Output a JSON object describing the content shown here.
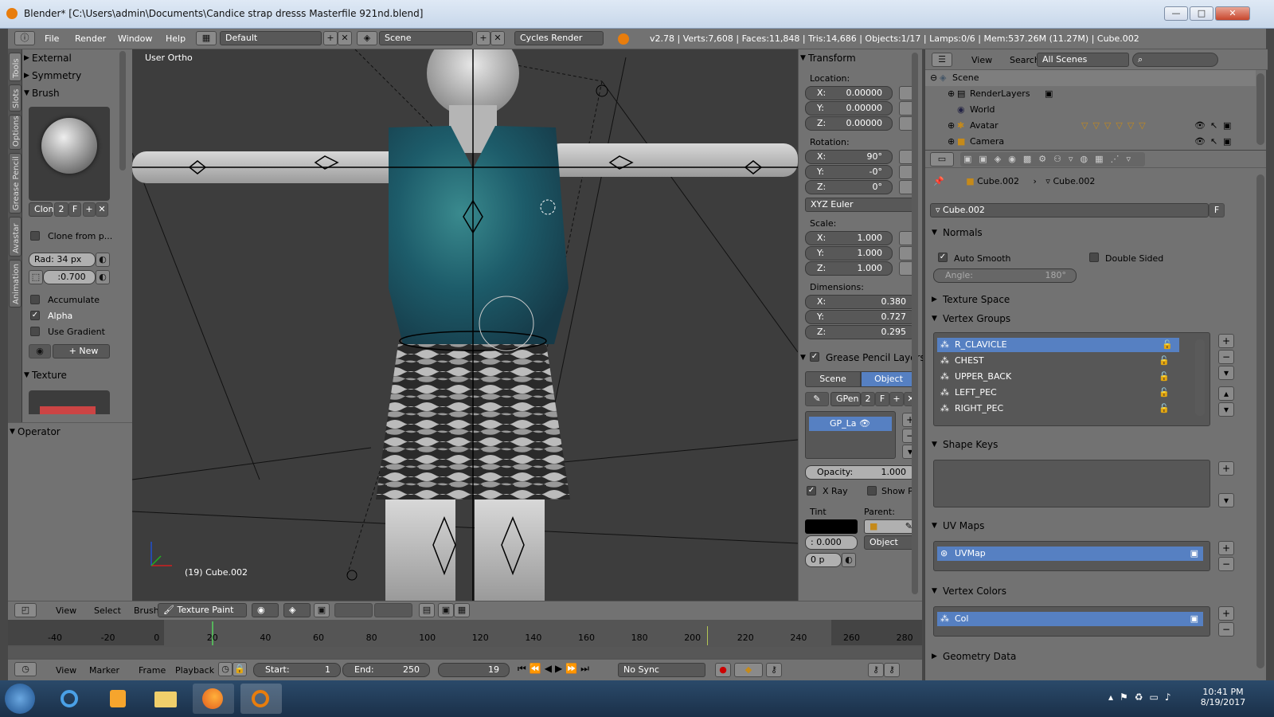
{
  "window": {
    "title": "Blender* [C:\\Users\\admin\\Documents\\Candice strap dresss Masterfile 921nd.blend]",
    "minimize": "—",
    "maximize": "□",
    "close": "✕"
  },
  "infobar": {
    "menus": [
      "File",
      "Render",
      "Window",
      "Help"
    ],
    "layout": "Default",
    "scene": "Scene",
    "engine": "Cycles Render",
    "stats": "v2.78 | Verts:7,608 | Faces:11,848 | Tris:14,686 | Objects:1/17 | Lamps:0/6 | Mem:537.26M (11.27M) | Cube.002"
  },
  "vtabs": [
    "Tools",
    "Slots",
    "Options",
    "Grease Pencil",
    "Avastar",
    "Animation"
  ],
  "toolshelf": {
    "external": "External",
    "symmetry": "Symmetry",
    "brush": "Brush",
    "brush_name": "Clon",
    "brush_users": "2",
    "brush_fake": "F",
    "clone_from": "Clone from p...",
    "radius": "Rad: 34 px",
    "strength": ":0.700",
    "accumulate": "Accumulate",
    "alpha": "Alpha",
    "use_gradient": "Use Gradient",
    "new_button": "New",
    "texture": "Texture",
    "operator": "Operator"
  },
  "viewport": {
    "view_name": "User Ortho",
    "object_label": "(19) Cube.002"
  },
  "npanel": {
    "transform": "Transform",
    "location_label": "Location:",
    "location": [
      {
        "k": "X:",
        "v": "0.00000"
      },
      {
        "k": "Y:",
        "v": "0.00000"
      },
      {
        "k": "Z:",
        "v": "0.00000"
      }
    ],
    "rotation_label": "Rotation:",
    "rotation": [
      {
        "k": "X:",
        "v": "90°"
      },
      {
        "k": "Y:",
        "v": "-0°"
      },
      {
        "k": "Z:",
        "v": "0°"
      }
    ],
    "rotation_mode": "XYZ Euler",
    "scale_label": "Scale:",
    "scale": [
      {
        "k": "X:",
        "v": "1.000"
      },
      {
        "k": "Y:",
        "v": "1.000"
      },
      {
        "k": "Z:",
        "v": "1.000"
      }
    ],
    "dimensions_label": "Dimensions:",
    "dimensions": [
      {
        "k": "X:",
        "v": "0.380"
      },
      {
        "k": "Y:",
        "v": "0.727"
      },
      {
        "k": "Z:",
        "v": "0.295"
      }
    ],
    "gp_layers": "Grease Pencil Layers",
    "tab_scene": "Scene",
    "tab_object": "Object",
    "gpen": "GPen",
    "gpen_users": "2",
    "gpen_fake": "F",
    "gp_layer": "GP_La",
    "opacity": "Opacity:",
    "opacity_value": "1.000",
    "xray": "X Ray",
    "show_points": "Show Po",
    "tint": "Tint",
    "parent": "Parent:",
    "tint_value": ": 0.000",
    "parent_type": "Object",
    "thickness": "0 p"
  },
  "outliner": {
    "view": "View",
    "search": "Search",
    "filter": "All Scenes",
    "rows": [
      "Scene",
      "RenderLayers",
      "World",
      "Avatar",
      "Camera"
    ]
  },
  "properties": {
    "breadcrumb_obj": "Cube.002",
    "breadcrumb_mesh": "Cube.002",
    "mesh_name": "Cube.002",
    "fake_user": "F",
    "normals": "Normals",
    "auto_smooth": "Auto Smooth",
    "double_sided": "Double Sided",
    "angle_label": "Angle:",
    "angle_value": "180°",
    "texture_space": "Texture Space",
    "vertex_groups": "Vertex Groups",
    "groups": [
      "R_CLAVICLE",
      "CHEST",
      "UPPER_BACK",
      "LEFT_PEC",
      "RIGHT_PEC"
    ],
    "shape_keys": "Shape Keys",
    "uv_maps": "UV Maps",
    "uv_map": "UVMap",
    "vertex_colors": "Vertex Colors",
    "vcol": "Col",
    "geometry_data": "Geometry Data"
  },
  "v3d_header": {
    "view": "View",
    "select": "Select",
    "brush": "Brush",
    "mode": "Texture Paint"
  },
  "timeline": {
    "ticks": [
      "-40",
      "-20",
      "0",
      "20",
      "40",
      "60",
      "80",
      "100",
      "120",
      "140",
      "160",
      "180",
      "200",
      "220",
      "240",
      "260",
      "280"
    ],
    "menus": [
      "View",
      "Marker",
      "Frame",
      "Playback"
    ],
    "start": "Start:",
    "start_value": "1",
    "end": "End:",
    "end_value": "250",
    "current": "19",
    "sync": "No Sync"
  },
  "taskbar": {
    "time": "10:41 PM",
    "date": "8/19/2017"
  },
  "colors": {
    "accent": "#5680c2",
    "panel": "#727272",
    "viewport": "#3d3d3d"
  }
}
